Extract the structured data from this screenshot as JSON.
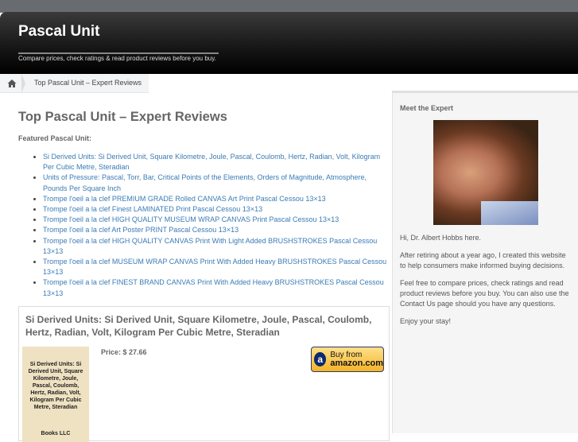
{
  "site": {
    "title": "Pascal Unit",
    "tagline": "Compare prices, check ratings & read product reviews before you buy."
  },
  "breadcrumb": {
    "home_icon": "home-icon",
    "current": "Top Pascal Unit – Expert Reviews"
  },
  "main": {
    "heading": "Top Pascal Unit – Expert Reviews",
    "featured_label": "Featured Pascal Unit:",
    "items": [
      "Si Derived Units: Si Derived Unit, Square Kilometre, Joule, Pascal, Coulomb, Hertz, Radian, Volt, Kilogram Per Cubic Metre, Steradian",
      "Units of Pressure: Pascal, Torr, Bar, Critical Points of the Elements, Orders of Magnitude, Atmosphere, Pounds Per Square Inch",
      "Trompe l'oeil a la clef PREMIUM GRADE Rolled CANVAS Art Print Pascal Cessou 13×13",
      "Trompe l'oeil a la clef Finest LAMINATED Print Pascal Cessou 13×13",
      "Trompe l'oeil a la clef HIGH QUALITY MUSEUM WRAP CANVAS Print Pascal Cessou 13×13",
      "Trompe l'oeil a la clef Art Poster PRINT Pascal Cessou 13×13",
      "Trompe l'oeil a la clef HIGH QUALITY CANVAS Print With Light Added BRUSHSTROKES Pascal Cessou 13×13",
      "Trompe l'oeil a la clef MUSEUM WRAP CANVAS Print With Added Heavy BRUSHSTROKES Pascal Cessou 13×13",
      "Trompe l'oeil a la clef FINEST BRAND CANVAS Print With Added Heavy BRUSHSTROKES Pascal Cessou 13×13"
    ],
    "product": {
      "title": "Si Derived Units: Si Derived Unit, Square Kilometre, Joule, Pascal, Coulomb, Hertz, Radian, Volt, Kilogram Per Cubic Metre, Steradian",
      "cover_title": "Si Derived Units: Si Derived Unit, Square Kilometre, Joule, Pascal, Coulomb, Hertz, Radian, Volt, Kilogram Per Cubic Metre, Steradian",
      "cover_publisher": "Books LLC",
      "price": "Price: $ 27.66",
      "buy_line1": "Buy from",
      "buy_line2": "amazon.com"
    }
  },
  "sidebar": {
    "title": "Meet the Expert",
    "paragraphs": [
      "Hi, Dr. Albert Hobbs here.",
      "After retiring about a year ago, I created this website to help consumers make informed buying decisions.",
      "Feel free to compare prices, check ratings and read product reviews before you buy. You can also use the Contact Us page should you have any questions.",
      "Enjoy your stay!"
    ]
  }
}
